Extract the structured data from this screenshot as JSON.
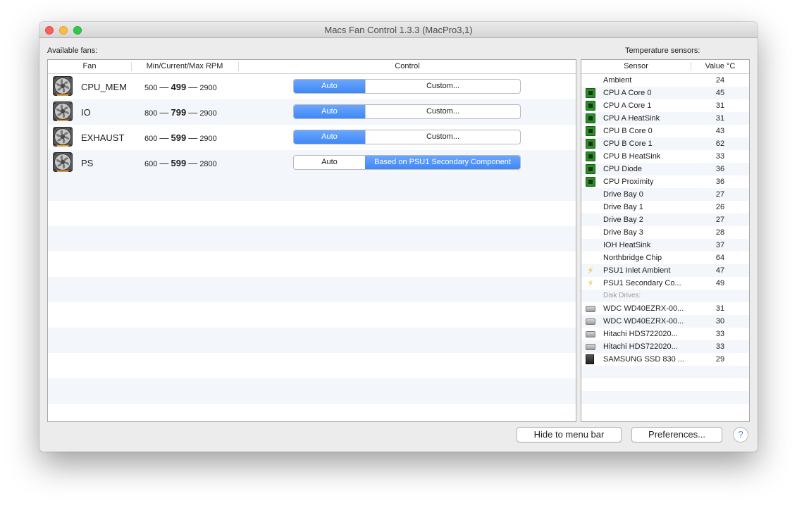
{
  "window": {
    "title": "Macs Fan Control 1.3.3 (MacPro3,1)"
  },
  "fans_panel": {
    "label": "Available fans:",
    "columns": {
      "fan": "Fan",
      "rpm": "Min/Current/Max RPM",
      "control": "Control"
    },
    "rows": [
      {
        "name": "CPU_MEM",
        "min": "500",
        "current": "499",
        "max": "2900",
        "auto": "Auto",
        "custom": "Custom...",
        "mode": "auto"
      },
      {
        "name": "IO",
        "min": "800",
        "current": "799",
        "max": "2900",
        "auto": "Auto",
        "custom": "Custom...",
        "mode": "auto"
      },
      {
        "name": "EXHAUST",
        "min": "600",
        "current": "599",
        "max": "2900",
        "auto": "Auto",
        "custom": "Custom...",
        "mode": "auto"
      },
      {
        "name": "PS",
        "min": "600",
        "current": "599",
        "max": "2800",
        "auto": "Auto",
        "custom": "Based on PSU1 Secondary Component",
        "mode": "custom"
      }
    ],
    "dash": "—"
  },
  "sensors_panel": {
    "label": "Temperature sensors:",
    "columns": {
      "sensor": "Sensor",
      "value": "Value °C"
    },
    "rows": [
      {
        "name": "Ambient",
        "value": "24",
        "icon": "none"
      },
      {
        "name": "CPU A Core 0",
        "value": "45",
        "icon": "cpu-chip-icon"
      },
      {
        "name": "CPU A Core 1",
        "value": "31",
        "icon": "cpu-chip-icon"
      },
      {
        "name": "CPU A HeatSink",
        "value": "31",
        "icon": "cpu-chip-icon"
      },
      {
        "name": "CPU B Core 0",
        "value": "43",
        "icon": "cpu-chip-icon"
      },
      {
        "name": "CPU B Core 1",
        "value": "62",
        "icon": "cpu-chip-icon"
      },
      {
        "name": "CPU B HeatSink",
        "value": "33",
        "icon": "cpu-chip-icon"
      },
      {
        "name": "CPU Diode",
        "value": "36",
        "icon": "cpu-chip-icon"
      },
      {
        "name": "CPU Proximity",
        "value": "36",
        "icon": "cpu-chip-icon"
      },
      {
        "name": "Drive Bay 0",
        "value": "27",
        "icon": "none"
      },
      {
        "name": "Drive Bay 1",
        "value": "26",
        "icon": "none"
      },
      {
        "name": "Drive Bay 2",
        "value": "27",
        "icon": "none"
      },
      {
        "name": "Drive Bay 3",
        "value": "28",
        "icon": "none"
      },
      {
        "name": "IOH HeatSink",
        "value": "37",
        "icon": "none"
      },
      {
        "name": "Northbridge Chip",
        "value": "64",
        "icon": "none"
      },
      {
        "name": "PSU1 Inlet Ambient",
        "value": "47",
        "icon": "power-bolt-icon"
      },
      {
        "name": "PSU1 Secondary Co...",
        "value": "49",
        "icon": "power-bolt-icon"
      },
      {
        "group": "Disk Drives:"
      },
      {
        "name": "WDC WD40EZRX-00...",
        "value": "31",
        "icon": "hard-drive-icon"
      },
      {
        "name": "WDC WD40EZRX-00...",
        "value": "30",
        "icon": "hard-drive-icon"
      },
      {
        "name": "Hitachi HDS722020...",
        "value": "33",
        "icon": "hard-drive-icon"
      },
      {
        "name": "Hitachi HDS722020...",
        "value": "33",
        "icon": "hard-drive-icon"
      },
      {
        "name": "SAMSUNG SSD 830 ...",
        "value": "29",
        "icon": "ssd-icon"
      }
    ]
  },
  "buttons": {
    "hide": "Hide to menu bar",
    "preferences": "Preferences...",
    "help": "?"
  },
  "colors": {
    "accent": "#3f88f8",
    "stripe": "#f3f6fa",
    "chip": "#2f8a2a",
    "bolt": "#e7b50c"
  }
}
